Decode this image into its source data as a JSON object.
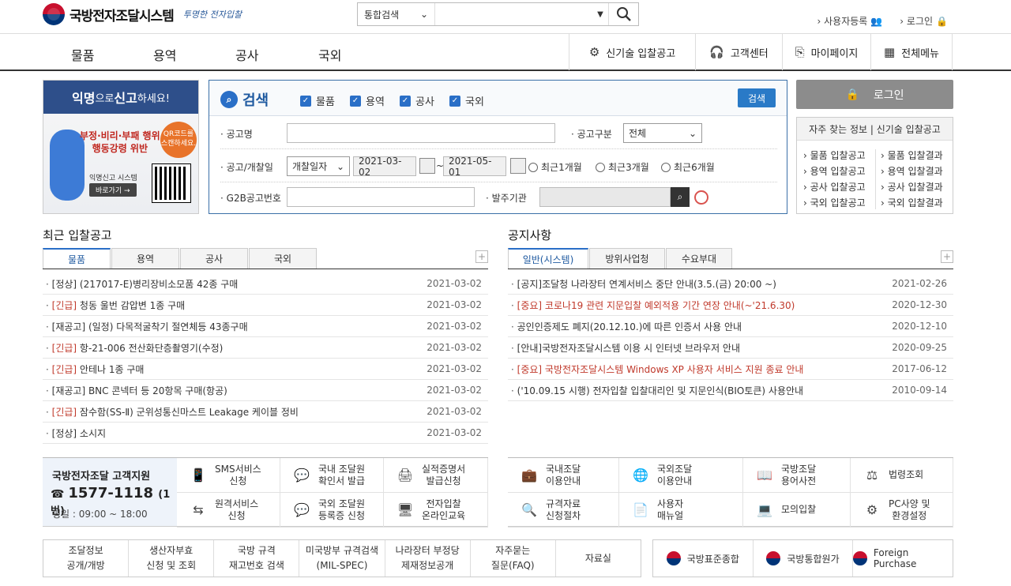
{
  "header": {
    "title": "국방전자조달시스템",
    "slogan": "투명한 전자입찰",
    "search_scope": "통합검색",
    "search_placeholder": "",
    "util": {
      "register": "사용자등록",
      "login": "로그인"
    }
  },
  "gnb": {
    "items": [
      "물품",
      "용역",
      "공사",
      "국외"
    ],
    "util": [
      "신기술 입찰공고",
      "고객센터",
      "마이페이지",
      "전체메뉴"
    ]
  },
  "banner": {
    "head_a": "익명",
    "head_b": "으로 ",
    "head_c": "신고",
    "head_d": "하세요!",
    "red_line1": "부정·비리·부패 행위",
    "red_line2": "행동강령 위반",
    "qr_text": "QR코드를 스캔하세요.",
    "sub": "익명신고 시스템",
    "go": "바로가기 →"
  },
  "search_panel": {
    "title": "검색",
    "checks": [
      "물품",
      "용역",
      "공사",
      "국외"
    ],
    "search_btn": "검색",
    "label_name": "공고명",
    "label_type": "공고구분",
    "type_value": "전체",
    "label_date": "공고/개찰일",
    "date_kind": "개찰일자",
    "date_from": "2021-03-02",
    "date_to": "2021-05-01",
    "tilde": "~",
    "radios": [
      "최근1개월",
      "최근3개월",
      "최근6개월"
    ],
    "label_g2b": "G2B공고번호",
    "label_org": "발주기관"
  },
  "login": {
    "button": "로그인"
  },
  "quick": {
    "head": "자주 찾는 정보 | 신기술 입찰공고",
    "left": [
      "물품 입찰공고",
      "용역 입찰공고",
      "공사 입찰공고",
      "국외 입찰공고"
    ],
    "right": [
      "물품 입찰결과",
      "용역 입찰결과",
      "공사 입찰결과",
      "국외 입찰결과"
    ]
  },
  "recent": {
    "title": "최근 입찰공고",
    "tabs": [
      "물품",
      "용역",
      "공사",
      "국외"
    ],
    "items": [
      {
        "pre": "",
        "text": "[정상] (217017-E)병리장비소모품 42종 구매",
        "date": "2021-03-02"
      },
      {
        "pre": "[긴급]",
        "text": " 청동 울번 감압변 1종 구매",
        "date": "2021-03-02"
      },
      {
        "pre": "",
        "text": "[재공고] (일정) 다목적굴착기 절연체등 43종구매",
        "date": "2021-03-02"
      },
      {
        "pre": "[긴급]",
        "text": " 항-21-006 전산화단층촬영기(수정)",
        "date": "2021-03-02"
      },
      {
        "pre": "[긴급]",
        "text": " 안테나 1종 구매",
        "date": "2021-03-02"
      },
      {
        "pre": "",
        "text": "[재공고] BNC 콘넥터 등 20항목 구매(항공)",
        "date": "2021-03-02"
      },
      {
        "pre": "[긴급]",
        "text": " 잠수함(SS-Ⅱ) 군위성통신마스트 Leakage 케이블 정비",
        "date": "2021-03-02"
      },
      {
        "pre": "",
        "text": "[정상] 소시지",
        "date": "2021-03-02"
      }
    ]
  },
  "notice": {
    "title": "공지사항",
    "tabs": [
      "일반(시스템)",
      "방위사업청",
      "수요부대"
    ],
    "items": [
      {
        "text": "[공지]조달청 나라장터 연계서비스 중단 안내(3.5.(금) 20:00 ~)",
        "date": "2021-02-26",
        "red": false
      },
      {
        "text": "[중요] 코로나19 관련 지문입찰 예외적용 기간 연장 안내(~'21.6.30)",
        "date": "2020-12-30",
        "red": true
      },
      {
        "text": "공인인증제도 폐지(20.12.10.)에 따른 인증서 사용 안내",
        "date": "2020-12-10",
        "red": false
      },
      {
        "text": "[안내]국방전자조달시스템 이용 시 인터넷 브라우저 안내",
        "date": "2020-09-25",
        "red": false
      },
      {
        "text": "[중요] 국방전자조달시스템 Windows XP 사용자 서비스 지원 종료 안내",
        "date": "2017-06-12",
        "red": true
      },
      {
        "text": "('10.09.15 시행) 전자입찰 입찰대리인 및 지문인식(BIO토큰) 사용안내",
        "date": "2010-09-14",
        "red": false
      }
    ]
  },
  "cs": {
    "title": "국방전자조달 고객지원",
    "phone": "1577-1118",
    "phone_suffix": "(1번)",
    "hours": "평일 : 09:00 ~ 18:00"
  },
  "services": [
    {
      "label": "SMS서비스\n신청",
      "icon": "phone-icon"
    },
    {
      "label": "국내 조달원\n확인서 발급",
      "icon": "chat-icon"
    },
    {
      "label": "실적증명서\n발급신청",
      "icon": "printer-icon"
    },
    {
      "label": "원격서비스\n신청",
      "icon": "share-icon"
    },
    {
      "label": "국외 조달원\n등록증 신청",
      "icon": "chat-icon"
    },
    {
      "label": "전자입찰\n온라인교육",
      "icon": "monitor-icon"
    },
    {
      "label": "국내조달\n이용안내",
      "icon": "briefcase-icon"
    },
    {
      "label": "국외조달\n이용안내",
      "icon": "globe-icon"
    },
    {
      "label": "국방조달\n용어사전",
      "icon": "book-icon"
    },
    {
      "label": "법령조회",
      "icon": "gavel-icon"
    },
    {
      "label": "규격자료\n신청절차",
      "icon": "search-doc-icon"
    },
    {
      "label": "사용자\n매뉴얼",
      "icon": "manual-icon"
    },
    {
      "label": "모의입찰",
      "icon": "laptop-icon"
    },
    {
      "label": "PC사양 및\n환경설정",
      "icon": "settings-icon"
    }
  ],
  "bottom_links": [
    "조달정보\n공개/개방",
    "생산자부효\n신청 및 조회",
    "국방 규격\n재고번호 검색",
    "미국방부 규격검색\n(MIL-SPEC)",
    "나라장터 부정당\n제재정보공개",
    "자주묻는\n질문(FAQ)",
    "자료실"
  ],
  "bottom_right": [
    "국방표준종합",
    "국방통합원가",
    "Foreign Purchase"
  ]
}
